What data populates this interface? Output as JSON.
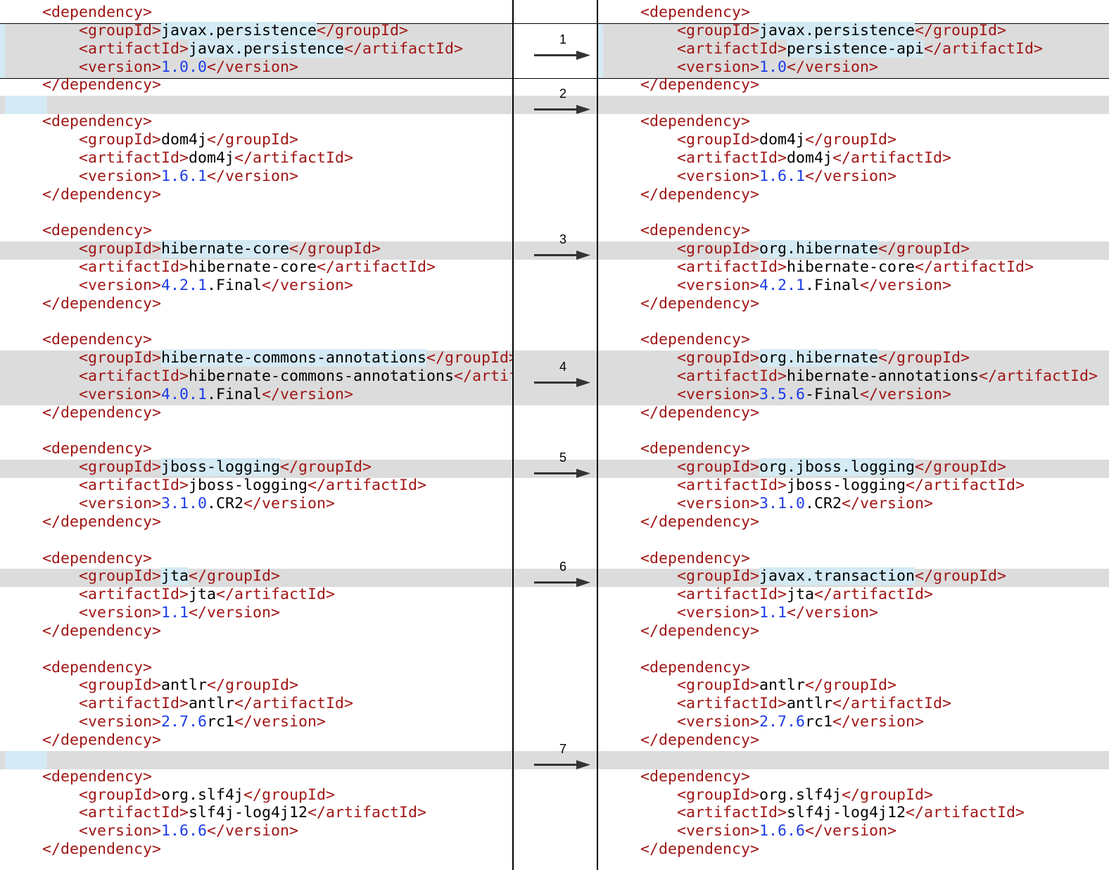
{
  "colors": {
    "tag": "#a11616",
    "text": "#000000",
    "number": "#1b3ce8",
    "changed_background": "#d4eaf4",
    "change_band": "#dcdcdc"
  },
  "left": {
    "lines": [
      [
        [
          "tag",
          "<dependency>"
        ]
      ],
      [
        [
          "tag",
          "<groupId>"
        ],
        [
          "hl",
          "javax.persistence"
        ],
        [
          "tag",
          "</groupId>"
        ]
      ],
      [
        [
          "tag",
          "<artifactId>"
        ],
        [
          "hl",
          "javax.persistence"
        ],
        [
          "tag",
          "</artifactId>"
        ]
      ],
      [
        [
          "tag",
          "<version>"
        ],
        [
          "num",
          "1.0.0"
        ],
        [
          "tag",
          "</version>"
        ]
      ],
      [
        [
          "tag",
          "</dependency>"
        ]
      ],
      [],
      [
        [
          "tag",
          "<dependency>"
        ]
      ],
      [
        [
          "tag",
          "<groupId>"
        ],
        [
          "txt",
          "dom4j"
        ],
        [
          "tag",
          "</groupId>"
        ]
      ],
      [
        [
          "tag",
          "<artifactId>"
        ],
        [
          "txt",
          "dom4j"
        ],
        [
          "tag",
          "</artifactId>"
        ]
      ],
      [
        [
          "tag",
          "<version>"
        ],
        [
          "num",
          "1.6.1"
        ],
        [
          "tag",
          "</version>"
        ]
      ],
      [
        [
          "tag",
          "</dependency>"
        ]
      ],
      [],
      [
        [
          "tag",
          "<dependency>"
        ]
      ],
      [
        [
          "tag",
          "<groupId>"
        ],
        [
          "hl",
          "hibernate-core"
        ],
        [
          "tag",
          "</groupId>"
        ]
      ],
      [
        [
          "tag",
          "<artifactId>"
        ],
        [
          "txt",
          "hibernate-core"
        ],
        [
          "tag",
          "</artifactId>"
        ]
      ],
      [
        [
          "tag",
          "<version>"
        ],
        [
          "num",
          "4.2.1"
        ],
        [
          "txt",
          ".Final"
        ],
        [
          "tag",
          "</version>"
        ]
      ],
      [
        [
          "tag",
          "</dependency>"
        ]
      ],
      [],
      [
        [
          "tag",
          "<dependency>"
        ]
      ],
      [
        [
          "tag",
          "<groupId>"
        ],
        [
          "hl",
          "hibernate-commons-annotations"
        ],
        [
          "tag",
          "</groupId>"
        ]
      ],
      [
        [
          "tag",
          "<artifactId>"
        ],
        [
          "txt",
          "hibernate-commons-annotations"
        ],
        [
          "tag",
          "</artifactId>"
        ]
      ],
      [
        [
          "tag",
          "<version>"
        ],
        [
          "num",
          "4.0.1"
        ],
        [
          "txt",
          ".Final"
        ],
        [
          "tag",
          "</version>"
        ]
      ],
      [
        [
          "tag",
          "</dependency>"
        ]
      ],
      [],
      [
        [
          "tag",
          "<dependency>"
        ]
      ],
      [
        [
          "tag",
          "<groupId>"
        ],
        [
          "hl",
          "jboss-logging"
        ],
        [
          "tag",
          "</groupId>"
        ]
      ],
      [
        [
          "tag",
          "<artifactId>"
        ],
        [
          "txt",
          "jboss-logging"
        ],
        [
          "tag",
          "</artifactId>"
        ]
      ],
      [
        [
          "tag",
          "<version>"
        ],
        [
          "num",
          "3.1.0"
        ],
        [
          "txt",
          ".CR2"
        ],
        [
          "tag",
          "</version>"
        ]
      ],
      [
        [
          "tag",
          "</dependency>"
        ]
      ],
      [],
      [
        [
          "tag",
          "<dependency>"
        ]
      ],
      [
        [
          "tag",
          "<groupId>"
        ],
        [
          "hl",
          "jta"
        ],
        [
          "tag",
          "</groupId>"
        ]
      ],
      [
        [
          "tag",
          "<artifactId>"
        ],
        [
          "txt",
          "jta"
        ],
        [
          "tag",
          "</artifactId>"
        ]
      ],
      [
        [
          "tag",
          "<version>"
        ],
        [
          "num",
          "1.1"
        ],
        [
          "tag",
          "</version>"
        ]
      ],
      [
        [
          "tag",
          "</dependency>"
        ]
      ],
      [],
      [
        [
          "tag",
          "<dependency>"
        ]
      ],
      [
        [
          "tag",
          "<groupId>"
        ],
        [
          "txt",
          "antlr"
        ],
        [
          "tag",
          "</groupId>"
        ]
      ],
      [
        [
          "tag",
          "<artifactId>"
        ],
        [
          "txt",
          "antlr"
        ],
        [
          "tag",
          "</artifactId>"
        ]
      ],
      [
        [
          "tag",
          "<version>"
        ],
        [
          "num",
          "2.7.6"
        ],
        [
          "txt",
          "rc1"
        ],
        [
          "tag",
          "</version>"
        ]
      ],
      [
        [
          "tag",
          "</dependency>"
        ]
      ],
      [],
      [
        [
          "tag",
          "<dependency>"
        ]
      ],
      [
        [
          "tag",
          "<groupId>"
        ],
        [
          "txt",
          "org.slf4j"
        ],
        [
          "tag",
          "</groupId>"
        ]
      ],
      [
        [
          "tag",
          "<artifactId>"
        ],
        [
          "txt",
          "slf4j-log4j12"
        ],
        [
          "tag",
          "</artifactId>"
        ]
      ],
      [
        [
          "tag",
          "<version>"
        ],
        [
          "num",
          "1.6.6"
        ],
        [
          "tag",
          "</version>"
        ]
      ],
      [
        [
          "tag",
          "</dependency>"
        ]
      ]
    ]
  },
  "right": {
    "lines": [
      [
        [
          "tag",
          "<dependency>"
        ]
      ],
      [
        [
          "tag",
          "<groupId>"
        ],
        [
          "hl",
          "javax.persistence"
        ],
        [
          "tag",
          "</groupId>"
        ]
      ],
      [
        [
          "tag",
          "<artifactId>"
        ],
        [
          "hl",
          "persistence-api"
        ],
        [
          "tag",
          "</artifactId>"
        ]
      ],
      [
        [
          "tag",
          "<version>"
        ],
        [
          "num",
          "1.0"
        ],
        [
          "tag",
          "</version>"
        ]
      ],
      [
        [
          "tag",
          "</dependency>"
        ]
      ],
      [],
      [
        [
          "tag",
          "<dependency>"
        ]
      ],
      [
        [
          "tag",
          "<groupId>"
        ],
        [
          "txt",
          "dom4j"
        ],
        [
          "tag",
          "</groupId>"
        ]
      ],
      [
        [
          "tag",
          "<artifactId>"
        ],
        [
          "txt",
          "dom4j"
        ],
        [
          "tag",
          "</artifactId>"
        ]
      ],
      [
        [
          "tag",
          "<version>"
        ],
        [
          "num",
          "1.6.1"
        ],
        [
          "tag",
          "</version>"
        ]
      ],
      [
        [
          "tag",
          "</dependency>"
        ]
      ],
      [],
      [
        [
          "tag",
          "<dependency>"
        ]
      ],
      [
        [
          "tag",
          "<groupId>"
        ],
        [
          "hl",
          "org.hibernate"
        ],
        [
          "tag",
          "</groupId>"
        ]
      ],
      [
        [
          "tag",
          "<artifactId>"
        ],
        [
          "txt",
          "hibernate-core"
        ],
        [
          "tag",
          "</artifactId>"
        ]
      ],
      [
        [
          "tag",
          "<version>"
        ],
        [
          "num",
          "4.2.1"
        ],
        [
          "txt",
          ".Final"
        ],
        [
          "tag",
          "</version>"
        ]
      ],
      [
        [
          "tag",
          "</dependency>"
        ]
      ],
      [],
      [
        [
          "tag",
          "<dependency>"
        ]
      ],
      [
        [
          "tag",
          "<groupId>"
        ],
        [
          "hl",
          "org.hibernate"
        ],
        [
          "tag",
          "</groupId>"
        ]
      ],
      [
        [
          "tag",
          "<artifactId>"
        ],
        [
          "txt",
          "hibernate-annotations"
        ],
        [
          "tag",
          "</artifactId>"
        ]
      ],
      [
        [
          "tag",
          "<version>"
        ],
        [
          "num",
          "3.5.6"
        ],
        [
          "txt",
          "-Final"
        ],
        [
          "tag",
          "</version>"
        ]
      ],
      [
        [
          "tag",
          "</dependency>"
        ]
      ],
      [],
      [
        [
          "tag",
          "<dependency>"
        ]
      ],
      [
        [
          "tag",
          "<groupId>"
        ],
        [
          "hl",
          "org.jboss.logging"
        ],
        [
          "tag",
          "</groupId>"
        ]
      ],
      [
        [
          "tag",
          "<artifactId>"
        ],
        [
          "txt",
          "jboss-logging"
        ],
        [
          "tag",
          "</artifactId>"
        ]
      ],
      [
        [
          "tag",
          "<version>"
        ],
        [
          "num",
          "3.1.0"
        ],
        [
          "txt",
          ".CR2"
        ],
        [
          "tag",
          "</version>"
        ]
      ],
      [
        [
          "tag",
          "</dependency>"
        ]
      ],
      [],
      [
        [
          "tag",
          "<dependency>"
        ]
      ],
      [
        [
          "tag",
          "<groupId>"
        ],
        [
          "hl",
          "javax.transaction"
        ],
        [
          "tag",
          "</groupId>"
        ]
      ],
      [
        [
          "tag",
          "<artifactId>"
        ],
        [
          "txt",
          "jta"
        ],
        [
          "tag",
          "</artifactId>"
        ]
      ],
      [
        [
          "tag",
          "<version>"
        ],
        [
          "num",
          "1.1"
        ],
        [
          "tag",
          "</version>"
        ]
      ],
      [
        [
          "tag",
          "</dependency>"
        ]
      ],
      [],
      [
        [
          "tag",
          "<dependency>"
        ]
      ],
      [
        [
          "tag",
          "<groupId>"
        ],
        [
          "txt",
          "antlr"
        ],
        [
          "tag",
          "</groupId>"
        ]
      ],
      [
        [
          "tag",
          "<artifactId>"
        ],
        [
          "txt",
          "antlr"
        ],
        [
          "tag",
          "</artifactId>"
        ]
      ],
      [
        [
          "tag",
          "<version>"
        ],
        [
          "num",
          "2.7.6"
        ],
        [
          "txt",
          "rc1"
        ],
        [
          "tag",
          "</version>"
        ]
      ],
      [
        [
          "tag",
          "</dependency>"
        ]
      ],
      [],
      [
        [
          "tag",
          "<dependency>"
        ]
      ],
      [
        [
          "tag",
          "<groupId>"
        ],
        [
          "txt",
          "org.slf4j"
        ],
        [
          "tag",
          "</groupId>"
        ]
      ],
      [
        [
          "tag",
          "<artifactId>"
        ],
        [
          "txt",
          "slf4j-log4j12"
        ],
        [
          "tag",
          "</artifactId>"
        ]
      ],
      [
        [
          "tag",
          "<version>"
        ],
        [
          "num",
          "1.6.6"
        ],
        [
          "tag",
          "</version>"
        ]
      ],
      [
        [
          "tag",
          "</dependency>"
        ]
      ]
    ]
  },
  "changes": [
    {
      "number": "1",
      "first_line": 1,
      "last_line": 3,
      "current": true,
      "left_marker": true,
      "right_marker": true
    },
    {
      "number": "2",
      "first_line": 5,
      "last_line": 5,
      "current": false,
      "left_marker": true,
      "right_marker": false
    },
    {
      "number": "3",
      "first_line": 13,
      "last_line": 13,
      "current": false,
      "left_marker": false,
      "right_marker": false
    },
    {
      "number": "4",
      "first_line": 19,
      "last_line": 21,
      "current": false,
      "left_marker": false,
      "right_marker": false
    },
    {
      "number": "5",
      "first_line": 25,
      "last_line": 25,
      "current": false,
      "left_marker": false,
      "right_marker": false
    },
    {
      "number": "6",
      "first_line": 31,
      "last_line": 31,
      "current": false,
      "left_marker": false,
      "right_marker": false
    },
    {
      "number": "7",
      "first_line": 41,
      "last_line": 41,
      "current": false,
      "left_marker": true,
      "right_marker": false
    }
  ]
}
